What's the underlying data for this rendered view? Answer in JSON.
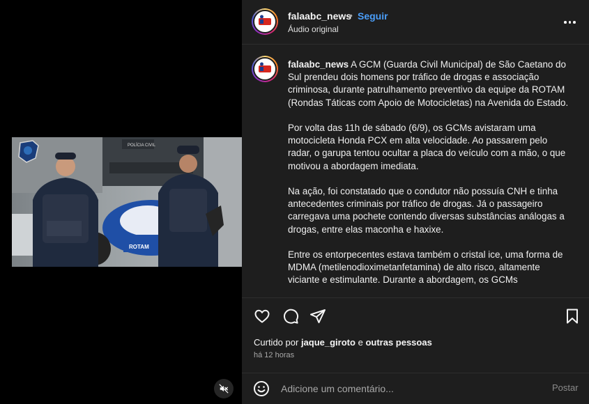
{
  "post": {
    "username": "falaabc_news",
    "separator": "•",
    "follow_label": "Seguir",
    "audio_label": "Áudio original",
    "more_icon": "more-horizontal-icon"
  },
  "caption": {
    "username": "falaabc_news",
    "paragraphs": [
      "A GCM (Guarda Civil Municipal) de São Caetano do Sul prendeu dois homens por tráfico de drogas e associação criminosa, durante patrulhamento preventivo da equipe da ROTAM (Rondas Táticas com Apoio de Motocicletas) na Avenida do Estado.",
      "Por volta das 11h de sábado (6/9), os GCMs avistaram uma motocicleta Honda PCX em alta velocidade. Ao passarem pelo radar, o garupa tentou ocultar a placa do veículo com a mão, o que motivou a abordagem imediata.",
      "Na ação, foi constatado que o condutor não possuía CNH e tinha antecedentes criminais por tráfico de drogas. Já o passageiro carregava uma pochete contendo diversas substâncias análogas a drogas, entre elas maconha e haxixe.",
      "Entre os entorpecentes estava também o cristal ice, uma forma de MDMA (metilenodioximetanfetamina) de alto risco, altamente viciante e estimulante. Durante a abordagem, os GCMs"
    ]
  },
  "media": {
    "sign_text": "POLÍCIA CIVIL",
    "bike_text": "ROTAM",
    "mute_icon": "volume-muted-icon"
  },
  "actions": {
    "like_icon": "heart-icon",
    "comment_icon": "comment-icon",
    "share_icon": "send-icon",
    "save_icon": "bookmark-icon"
  },
  "likes": {
    "prefix": "Curtido por",
    "user": "jaque_giroto",
    "conjunction": "e",
    "others": "outras pessoas"
  },
  "time_ago": "há 12 horas",
  "comment_box": {
    "placeholder": "Adicione um comentário...",
    "post_label": "Postar",
    "emoji_icon": "emoji-icon"
  },
  "colors": {
    "panel_bg": "#1e1e1e",
    "follow_blue": "#4a9df8",
    "muted_text": "#a8a8a8"
  }
}
